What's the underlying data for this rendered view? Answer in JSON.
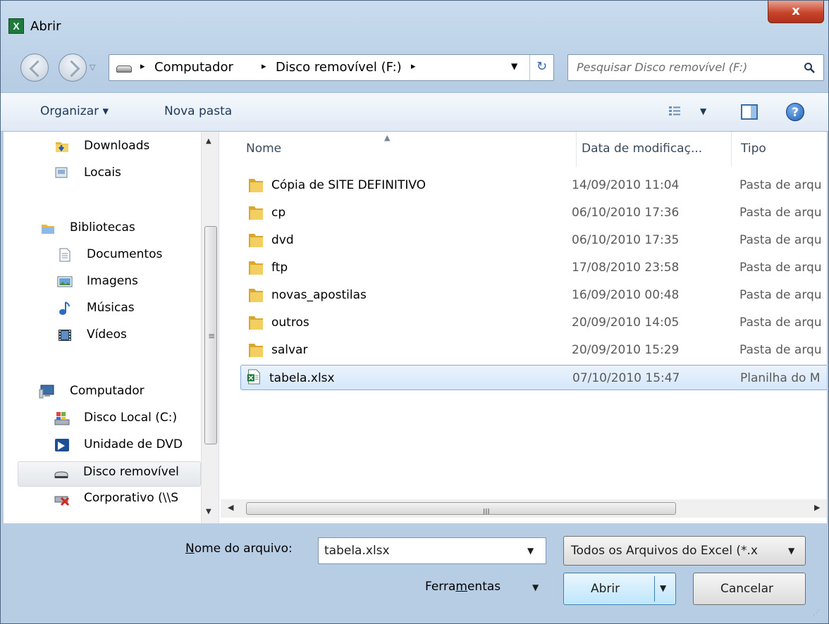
{
  "window": {
    "title": "Abrir",
    "close_glyph": "x",
    "accent": "#c8442b"
  },
  "address": {
    "crumbs": [
      "Computador",
      "Disco removível (F:)"
    ],
    "sep": "▸",
    "search_placeholder": "Pesquisar Disco removível (F:)"
  },
  "toolbar": {
    "organize": "Organizar ▾",
    "new_folder": "Nova pasta",
    "help": "?"
  },
  "nav": {
    "items": [
      {
        "label": "Downloads",
        "icon": "downloads-folder-icon"
      },
      {
        "label": "Locais",
        "icon": "places-icon"
      },
      {
        "label": "Bibliotecas",
        "icon": "libraries-icon"
      },
      {
        "label": "Documentos",
        "icon": "documents-icon"
      },
      {
        "label": "Imagens",
        "icon": "pictures-icon"
      },
      {
        "label": "Músicas",
        "icon": "music-icon"
      },
      {
        "label": "Vídeos",
        "icon": "videos-icon"
      },
      {
        "label": "Computador",
        "icon": "computer-icon"
      },
      {
        "label": "Disco Local (C:)",
        "icon": "local-disk-icon"
      },
      {
        "label": "Unidade de DVD",
        "icon": "dvd-drive-icon"
      },
      {
        "label": "Disco removível",
        "icon": "removable-disk-icon"
      },
      {
        "label": "Corporativo (\\\\S",
        "icon": "network-drive-disconnected-icon"
      }
    ]
  },
  "columns": {
    "name": "Nome",
    "date": "Data de modificaç...",
    "type": "Tipo"
  },
  "files": [
    {
      "name": "Cópia de SITE DEFINITIVO",
      "date": "14/09/2010 11:04",
      "type": "Pasta de arqu",
      "icon": "folder-icon"
    },
    {
      "name": "cp",
      "date": "06/10/2010 17:36",
      "type": "Pasta de arqu",
      "icon": "folder-icon"
    },
    {
      "name": "dvd",
      "date": "06/10/2010 17:35",
      "type": "Pasta de arqu",
      "icon": "folder-icon"
    },
    {
      "name": "ftp",
      "date": "17/08/2010 23:58",
      "type": "Pasta de arqu",
      "icon": "folder-icon"
    },
    {
      "name": "novas_apostilas",
      "date": "16/09/2010 00:48",
      "type": "Pasta de arqu",
      "icon": "folder-icon"
    },
    {
      "name": "outros",
      "date": "20/09/2010 14:05",
      "type": "Pasta de arqu",
      "icon": "folder-icon"
    },
    {
      "name": "salvar",
      "date": "20/09/2010 15:29",
      "type": "Pasta de arqu",
      "icon": "folder-icon"
    },
    {
      "name": "tabela.xlsx",
      "date": "07/10/2010 15:47",
      "type": "Planilha do M",
      "icon": "excel-file-icon"
    }
  ],
  "bottom": {
    "filename_label_pre": "N",
    "filename_label_post": "ome do arquivo:",
    "filename_value": "tabela.xlsx",
    "filter_value": "Todos os Arquivos do Excel (*.x",
    "tools_pre": "Ferra",
    "tools_u": "m",
    "tools_post": "entas",
    "open": "Abrir",
    "cancel": "Cancelar"
  }
}
